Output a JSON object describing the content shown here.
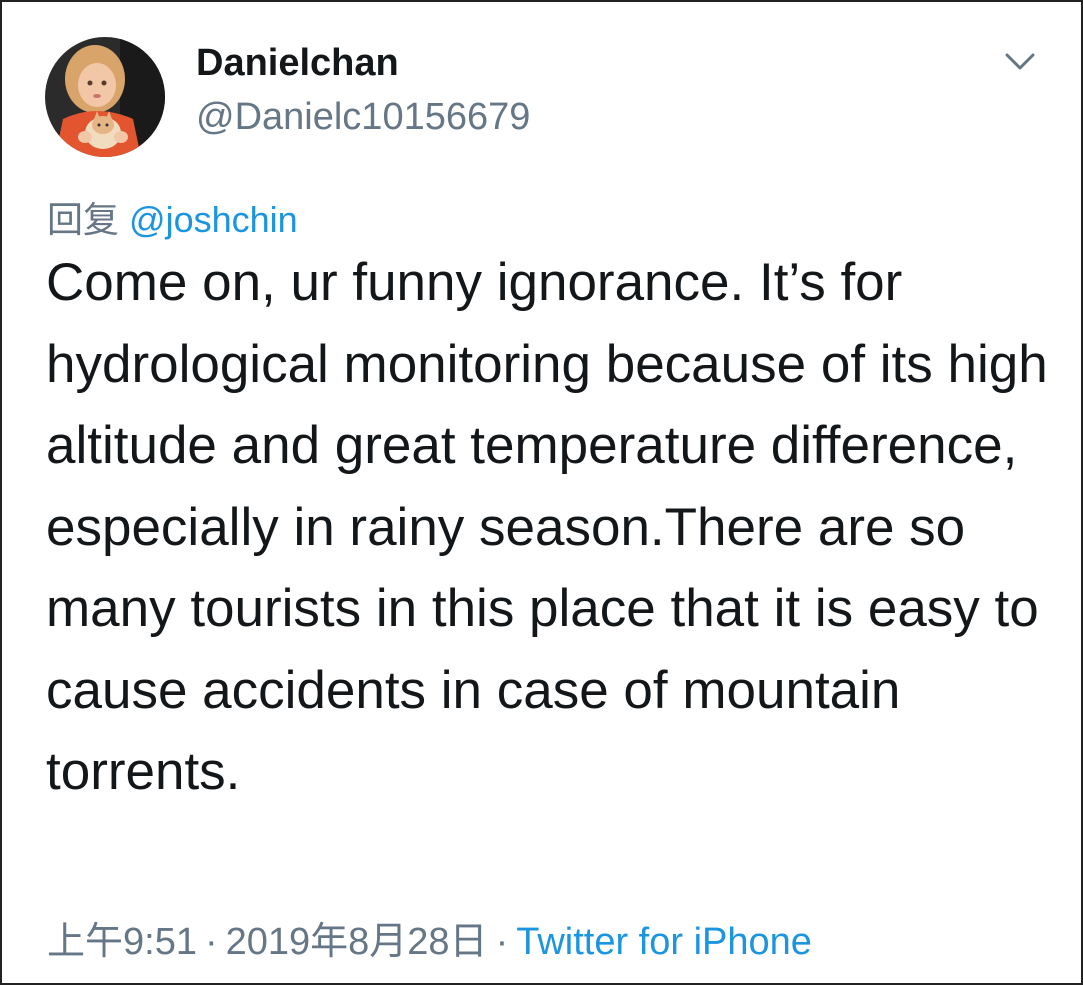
{
  "tweet": {
    "author": {
      "display_name": "Danielchan",
      "handle": "@Danielc10156679",
      "avatar_icon": "avatar-photo-child-with-cat"
    },
    "menu_icon": "chevron-down-icon",
    "reply": {
      "prefix": "回复",
      "mention": "@joshchin"
    },
    "text": "Come on, ur funny ignorance. It’s for hydrological monitoring because of its high altitude and great temperature difference, especially in rainy season.There are so many tourists in this place that it is easy to cause accidents in case of mountain torrents.",
    "meta": {
      "time": "上午9:51",
      "separator": "·",
      "date": "2019年8月28日",
      "source": "Twitter for iPhone"
    }
  },
  "colors": {
    "text_primary": "#14171a",
    "text_secondary": "#657786",
    "link": "#1b95e0",
    "border": "#222222",
    "background": "#ffffff"
  }
}
